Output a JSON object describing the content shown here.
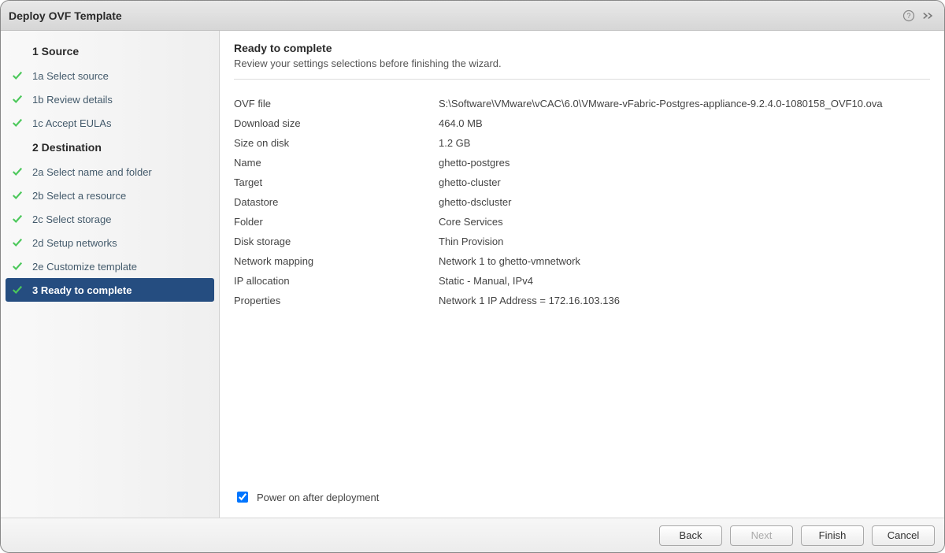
{
  "title": "Deploy OVF Template",
  "nav": {
    "section1": "1  Source",
    "s1a": "1a Select source",
    "s1b": "1b Review details",
    "s1c": "1c Accept EULAs",
    "section2": "2  Destination",
    "s2a": "2a Select name and folder",
    "s2b": "2b Select a resource",
    "s2c": "2c Select storage",
    "s2d": "2d Setup networks",
    "s2e": "2e Customize template",
    "s3": "3  Ready to complete"
  },
  "page": {
    "title": "Ready to complete",
    "subtitle": "Review your settings selections before finishing the wizard."
  },
  "settings": [
    {
      "k": "OVF file",
      "v": "S:\\Software\\VMware\\vCAC\\6.0\\VMware-vFabric-Postgres-appliance-9.2.4.0-1080158_OVF10.ova"
    },
    {
      "k": "Download size",
      "v": "464.0 MB"
    },
    {
      "k": "Size on disk",
      "v": "1.2 GB"
    },
    {
      "k": "Name",
      "v": "ghetto-postgres"
    },
    {
      "k": "Target",
      "v": "ghetto-cluster"
    },
    {
      "k": "Datastore",
      "v": "ghetto-dscluster"
    },
    {
      "k": "Folder",
      "v": "Core Services"
    },
    {
      "k": "Disk storage",
      "v": "Thin Provision"
    },
    {
      "k": "Network mapping",
      "v": "Network 1 to ghetto-vmnetwork"
    },
    {
      "k": "IP allocation",
      "v": "Static - Manual, IPv4"
    },
    {
      "k": "Properties",
      "v": "Network 1 IP Address = 172.16.103.136"
    }
  ],
  "power_on_label": "Power on after deployment",
  "power_on_checked": true,
  "buttons": {
    "back": "Back",
    "next": "Next",
    "finish": "Finish",
    "cancel": "Cancel"
  }
}
